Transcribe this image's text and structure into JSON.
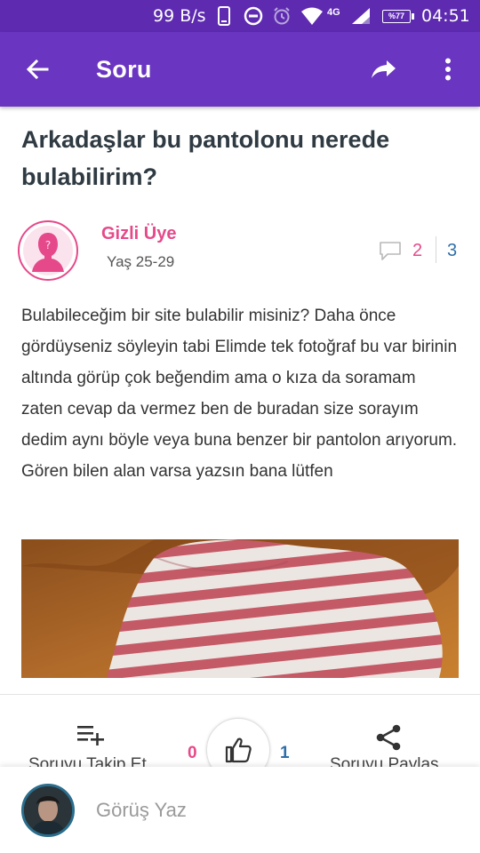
{
  "status_bar": {
    "net_speed": "99 B/s",
    "network": "4G",
    "battery": "%77",
    "time": "04:51"
  },
  "app_bar": {
    "title": "Soru",
    "icons": [
      "back-arrow-icon",
      "share-icon",
      "more-vert-icon"
    ]
  },
  "question": {
    "title": "Arkadaşlar bu pantolonu nerede bulabilirim?",
    "author": {
      "name": "Gizli Üye",
      "age": "Yaş 25-29"
    },
    "comment_count": "2",
    "answer_count": "3",
    "body": "Bulabileceğim bir site bulabilir misiniz? Daha önce gördüyseniz söyleyin tabi Elimde tek fotoğraf bu var birinin altında görüp çok beğendim ama o kıza da soramam zaten cevap da vermez ben de buradan size sorayım dedim aynı böyle veya buna benzer bir pantolon arıyorum. Gören bilen alan varsa yazsın bana lütfen"
  },
  "actions": {
    "follow_label": "Soruyu Takip Et",
    "dislike_count": "0",
    "like_count": "1",
    "share_label": "Soruyu Paylaş"
  },
  "comment_input": {
    "placeholder": "Görüş Yaz"
  },
  "colors": {
    "app_bar": "#6a35c0",
    "status_bar": "#5e2bb0",
    "accent_pink": "#e6498a",
    "accent_blue": "#2f6fa8"
  }
}
